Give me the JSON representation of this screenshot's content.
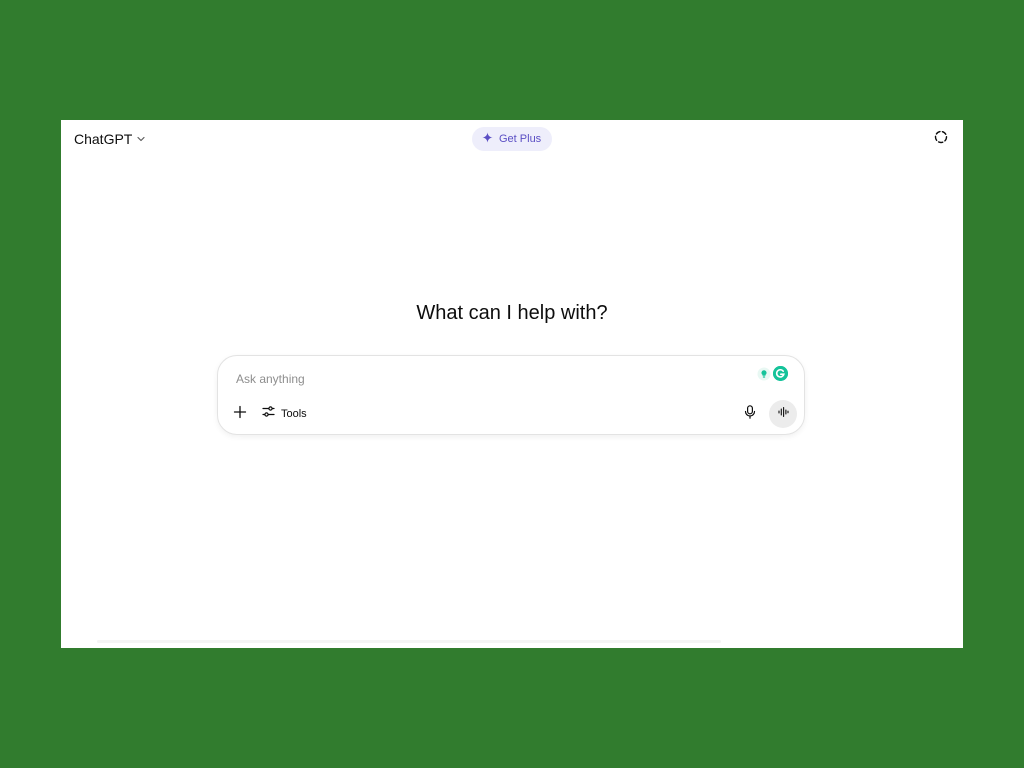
{
  "header": {
    "model_label": "ChatGPT",
    "upgrade_label": "Get Plus"
  },
  "main": {
    "headline": "What can I help with?"
  },
  "composer": {
    "placeholder": "Ask anything",
    "value": "",
    "tools_label": "Tools"
  },
  "colors": {
    "background": "#317c2e",
    "upgrade_pill_bg": "#eeeefb",
    "upgrade_text": "#5b4fc4",
    "grammarly_green": "#15c39a"
  },
  "icons": {
    "model_dropdown": "chevron-down-icon",
    "upgrade": "sparkle-icon",
    "temporary_chat": "dashed-circle-icon",
    "attach": "plus-icon",
    "tools": "sliders-icon",
    "dictate": "microphone-icon",
    "voice_mode": "sound-wave-icon",
    "grammarly_assist": "lightbulb-icon",
    "grammarly": "grammarly-logo-icon"
  }
}
